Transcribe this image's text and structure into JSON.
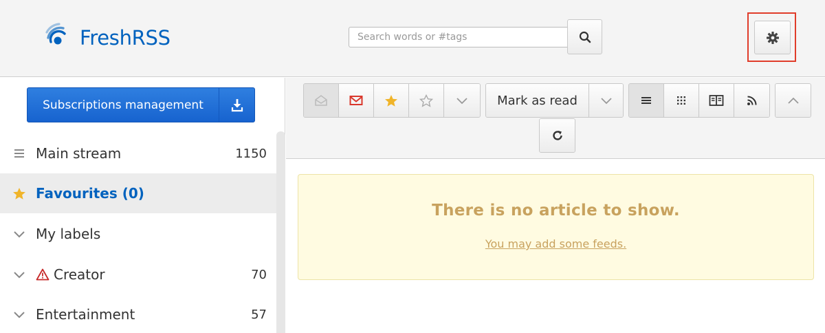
{
  "app": {
    "name": "FreshRSS"
  },
  "search": {
    "placeholder": "Search words or #tags"
  },
  "sidebar": {
    "subscriptions_label": "Subscriptions management",
    "items": [
      {
        "label": "Main stream",
        "count": "1150",
        "icon": "list-icon"
      },
      {
        "label": "Favourites (0)",
        "count": "",
        "icon": "star-icon"
      },
      {
        "label": "My labels",
        "count": "",
        "icon": "chevron-down-icon"
      },
      {
        "label": "Creator",
        "count": "70",
        "icon": "chevron-down-icon"
      },
      {
        "label": "Entertainment",
        "count": "57",
        "icon": "chevron-down-icon"
      }
    ]
  },
  "toolbar": {
    "mark_as_read": "Mark as read"
  },
  "content": {
    "empty_title": "There is no article to show.",
    "empty_link": "You may add some feeds."
  },
  "colors": {
    "brand": "#0062be",
    "primary_button": "#1763cf",
    "highlight_border": "#e03c2a",
    "notice_bg": "#fffbe1",
    "notice_text": "#c8a25e",
    "star": "#f0b429",
    "unread_mail": "#d9372b",
    "warning": "#c62828"
  }
}
